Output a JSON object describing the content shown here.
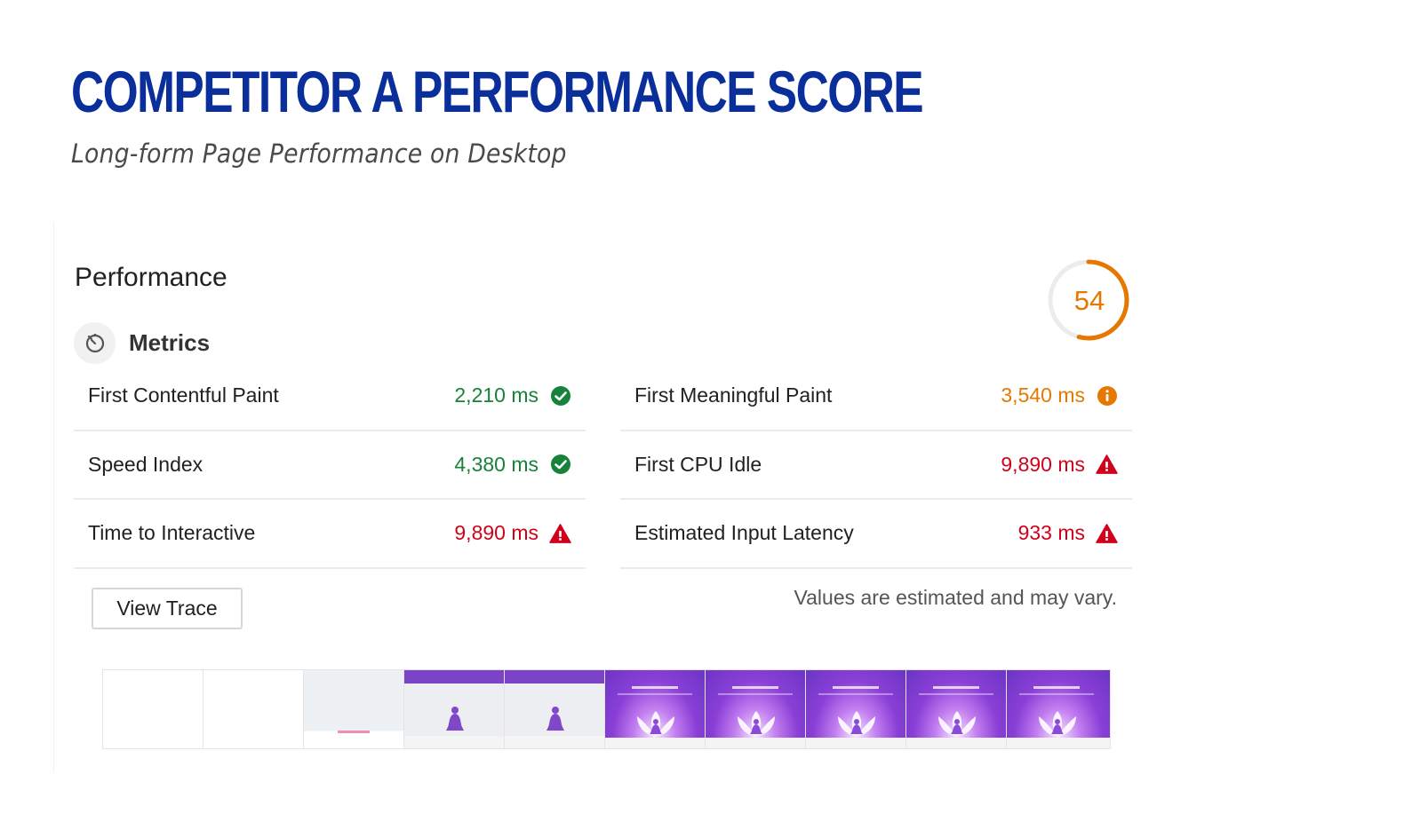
{
  "slide": {
    "title": "COMPETITOR A PERFORMANCE SCORE",
    "subtitle": "Long-form Page Performance on Desktop"
  },
  "performance": {
    "title": "Performance",
    "score": 54,
    "score_display": "54",
    "score_color": "#e67700",
    "metrics_label": "Metrics",
    "metrics_icon": "stopwatch-icon",
    "metrics_left": [
      {
        "name": "First Contentful Paint",
        "value": "2,210 ms",
        "status": "pass",
        "icon": "check-circle-icon"
      },
      {
        "name": "Speed Index",
        "value": "4,380 ms",
        "status": "pass",
        "icon": "check-circle-icon"
      },
      {
        "name": "Time to Interactive",
        "value": "9,890 ms",
        "status": "fail",
        "icon": "warning-triangle-icon"
      }
    ],
    "metrics_right": [
      {
        "name": "First Meaningful Paint",
        "value": "3,540 ms",
        "status": "average",
        "icon": "info-circle-icon"
      },
      {
        "name": "First CPU Idle",
        "value": "9,890 ms",
        "status": "fail",
        "icon": "warning-triangle-icon"
      },
      {
        "name": "Estimated Input Latency",
        "value": "933 ms",
        "status": "fail",
        "icon": "warning-triangle-icon"
      }
    ],
    "status_colors": {
      "pass": "#178239",
      "average": "#e67700",
      "fail": "#d0021b"
    },
    "view_trace_label": "View Trace",
    "disclaimer": "Values are estimated and may vary.",
    "filmstrip": [
      "blank",
      "blank",
      "loading",
      "partial",
      "partial",
      "full",
      "full",
      "full",
      "full",
      "full"
    ]
  }
}
